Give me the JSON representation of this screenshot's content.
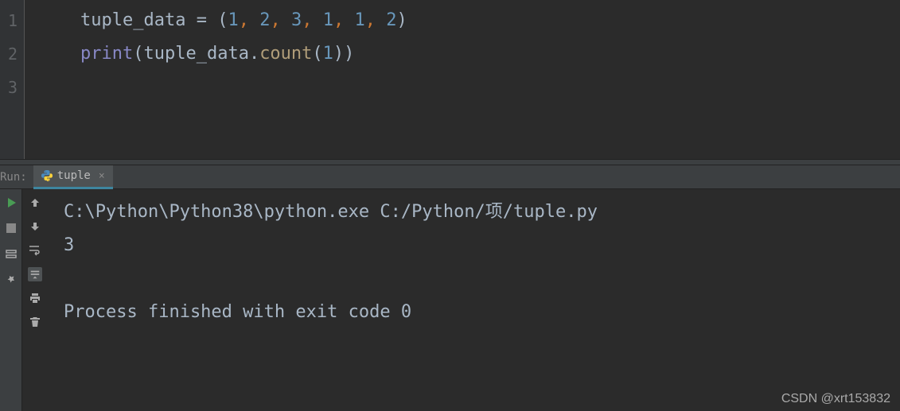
{
  "editor": {
    "line_numbers": [
      "1",
      "2",
      "3"
    ],
    "line1": {
      "var": "tuple_data",
      "eq": " = ",
      "open": "(",
      "n1": "1",
      "c1": ", ",
      "n2": "2",
      "c2": ", ",
      "n3": "3",
      "c3": ", ",
      "n4": "1",
      "c4": ", ",
      "n5": "1",
      "c5": ", ",
      "n6": "2",
      "close": ")"
    },
    "line2": {
      "func": "print",
      "open1": "(",
      "var": "tuple_data",
      "dot": ".",
      "method": "count",
      "open2": "(",
      "arg": "1",
      "close2": ")",
      "close1": ")"
    }
  },
  "run": {
    "label": "Run:",
    "tab_name": "tuple",
    "output_line1": "C:\\Python\\Python38\\python.exe C:/Python/项/tuple.py",
    "output_line2": "3",
    "output_line3": "",
    "output_line4": "Process finished with exit code 0"
  },
  "watermark": "CSDN @xrt153832"
}
